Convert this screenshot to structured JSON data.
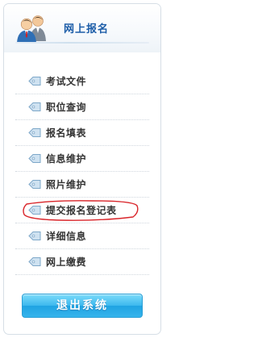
{
  "header": {
    "title": "网上报名",
    "icon": "users-icon"
  },
  "menu": {
    "icon": "tag-icon",
    "items": [
      {
        "label": "考试文件"
      },
      {
        "label": "职位查询"
      },
      {
        "label": "报名填表"
      },
      {
        "label": "信息维护"
      },
      {
        "label": "照片维护"
      },
      {
        "label": "提交报名登记表",
        "highlighted": true
      },
      {
        "label": "详细信息"
      },
      {
        "label": "网上缴费"
      }
    ]
  },
  "logout": {
    "label": "退出系统"
  },
  "colors": {
    "title": "#1c5da8",
    "tag": "#8fb8d8",
    "highlight": "#d9252a",
    "button": "#35b4ec"
  }
}
